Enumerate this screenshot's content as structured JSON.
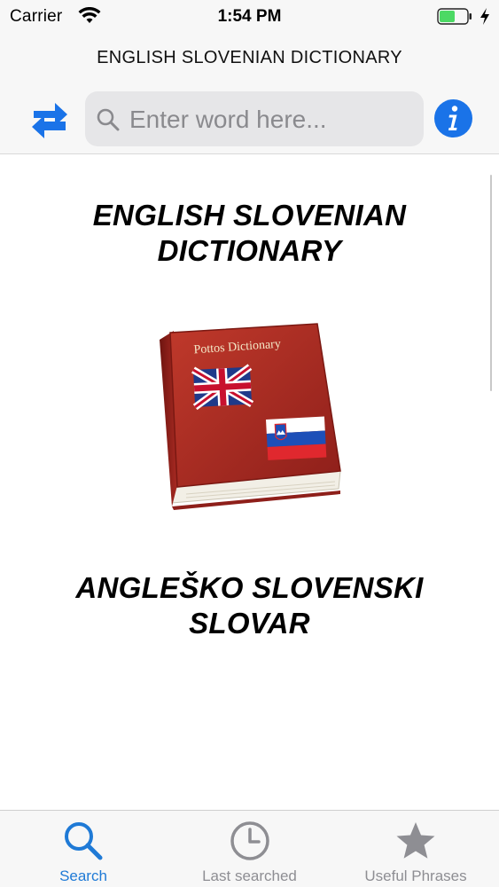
{
  "status_bar": {
    "carrier": "Carrier",
    "time": "1:54 PM",
    "battery_color": "#4cd964"
  },
  "nav": {
    "title": "ENGLISH SLOVENIAN DICTIONARY",
    "swap_icon": "swap-arrows-icon",
    "info_icon": "info-icon",
    "accent_color": "#1a73e8"
  },
  "search": {
    "placeholder": "Enter word here...",
    "value": ""
  },
  "main": {
    "heading_en": "ENGLISH SLOVENIAN DICTIONARY",
    "heading_sl": "ANGLEŠKO SLOVENSKI SLOVAR",
    "book_cover_text": "Pottos Dictionary",
    "book_color": "#a52a2a"
  },
  "tab_bar": {
    "tabs": [
      {
        "label": "Search",
        "icon": "search-icon",
        "active": true
      },
      {
        "label": "Last searched",
        "icon": "clock-icon",
        "active": false
      },
      {
        "label": "Useful Phrases",
        "icon": "star-icon",
        "active": false
      }
    ],
    "active_color": "#1f7ad6",
    "inactive_color": "#8e8e93"
  }
}
